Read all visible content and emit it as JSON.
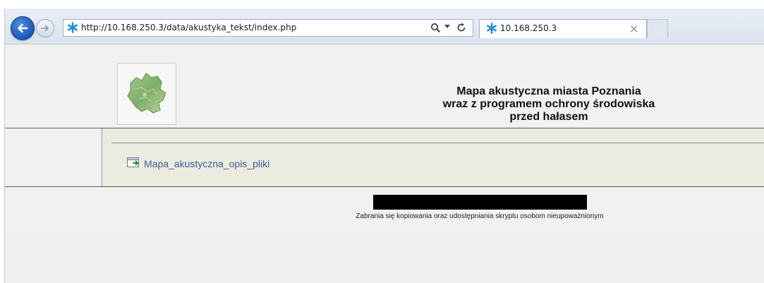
{
  "browser": {
    "url": "http://10.168.250.3/data/akustyka_tekst/index.php",
    "tab_title": "10.168.250.3",
    "tab_close": "×",
    "icons": {
      "back": "arrow-left-icon",
      "forward": "arrow-right-icon",
      "favicon": "asterisk-favicon-icon",
      "search": "search-icon",
      "refresh": "refresh-icon",
      "close": "close-icon"
    },
    "colors": {
      "favicon": "#1e8fd6",
      "back_button": "#1a56b8"
    }
  },
  "header": {
    "title_lines": [
      "Mapa akustyczna miasta Poznania",
      "wraz z programem ochrony środowiska",
      "przed hałasem"
    ],
    "logo": "poznan-city-map-icon"
  },
  "content": {
    "links": [
      {
        "label": "Mapa_akustyczna_opis_pliki",
        "icon": "shortcut-file-icon"
      }
    ],
    "link_color": "#3a5d97",
    "background": "#ecebdf"
  },
  "footer": {
    "notice": "Zabrania się kopiowania oraz udostępniania skryptu osobom nieupoważnionym"
  }
}
